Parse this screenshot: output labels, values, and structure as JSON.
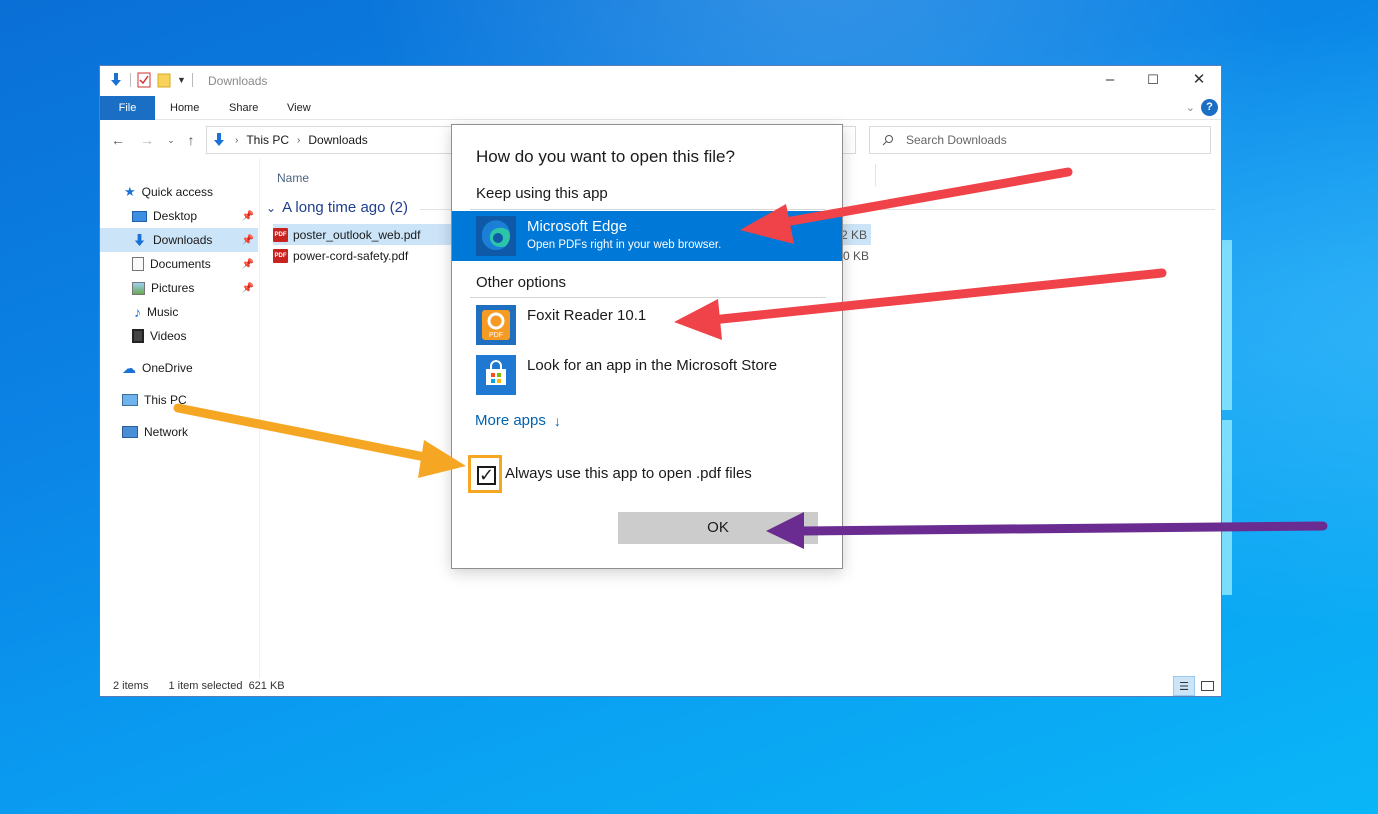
{
  "explorer": {
    "title": "Downloads",
    "ribbon_tabs": [
      "File",
      "Home",
      "Share",
      "View"
    ],
    "breadcrumb": [
      "This PC",
      "Downloads"
    ],
    "search_placeholder": "Search Downloads",
    "sidebar": [
      {
        "label": "Quick access",
        "icon": "star-icon",
        "pinned": false
      },
      {
        "label": "Desktop",
        "icon": "desktop-icon",
        "pinned": true
      },
      {
        "label": "Downloads",
        "icon": "download-arrow-icon",
        "pinned": true,
        "selected": true
      },
      {
        "label": "Documents",
        "icon": "documents-icon",
        "pinned": true
      },
      {
        "label": "Pictures",
        "icon": "pictures-icon",
        "pinned": true
      },
      {
        "label": "Music",
        "icon": "music-icon",
        "pinned": false
      },
      {
        "label": "Videos",
        "icon": "videos-icon",
        "pinned": false
      },
      {
        "label": "OneDrive",
        "icon": "cloud-icon",
        "pinned": false
      },
      {
        "label": "This PC",
        "icon": "computer-icon",
        "pinned": false
      },
      {
        "label": "Network",
        "icon": "network-icon",
        "pinned": false
      }
    ],
    "column_header": "Name",
    "group_label": "A long time ago (2)",
    "files": [
      {
        "name": "poster_outlook_web.pdf",
        "size": "2 KB",
        "selected": true
      },
      {
        "name": "power-cord-safety.pdf",
        "size": "0 KB",
        "selected": false
      }
    ],
    "status": {
      "items": "2 items",
      "selection": "1 item selected  621 KB"
    }
  },
  "dialog": {
    "title": "How do you want to open this file?",
    "keep_label": "Keep using this app",
    "current_app": {
      "name": "Microsoft Edge",
      "desc": "Open PDFs right in your web browser.",
      "icon": "edge-icon"
    },
    "other_label": "Other options",
    "other_apps": [
      {
        "name": "Foxit Reader 10.1",
        "icon": "foxit-icon"
      },
      {
        "name": "Look for an app in the Microsoft Store",
        "icon": "store-icon"
      }
    ],
    "more_apps": "More apps",
    "always_use": "Always use this app to open .pdf files",
    "always_checked": true,
    "ok": "OK"
  },
  "colors": {
    "accent": "#0078d7",
    "arrow_red": "#ef4349",
    "arrow_orange": "#f5a623",
    "arrow_purple": "#6a2c91"
  }
}
